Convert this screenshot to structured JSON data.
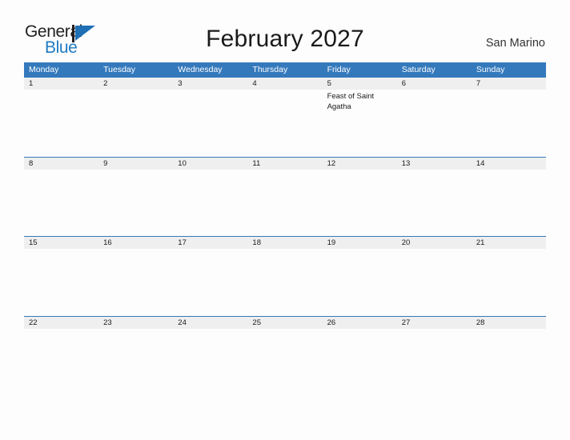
{
  "brand": {
    "name_part1": "General",
    "name_part2": "Blue",
    "mark_icon": "triangle-flag-icon",
    "primary_color": "#1f6fb4",
    "dark_color": "#231f20"
  },
  "header": {
    "title": "February 2027",
    "region": "San Marino"
  },
  "theme": {
    "header_blue": "#3479bc",
    "daynum_band_gray": "#efefef",
    "page_background": "#fdfdfd",
    "text_color": "#1a1a1a"
  },
  "calendar": {
    "month": "February",
    "year": "2027",
    "weekday_headers": [
      "Monday",
      "Tuesday",
      "Wednesday",
      "Thursday",
      "Friday",
      "Saturday",
      "Sunday"
    ],
    "weeks": [
      {
        "days": [
          {
            "number": "1",
            "events": []
          },
          {
            "number": "2",
            "events": []
          },
          {
            "number": "3",
            "events": []
          },
          {
            "number": "4",
            "events": []
          },
          {
            "number": "5",
            "events": [
              "Feast of Saint Agatha"
            ]
          },
          {
            "number": "6",
            "events": []
          },
          {
            "number": "7",
            "events": []
          }
        ]
      },
      {
        "days": [
          {
            "number": "8",
            "events": []
          },
          {
            "number": "9",
            "events": []
          },
          {
            "number": "10",
            "events": []
          },
          {
            "number": "11",
            "events": []
          },
          {
            "number": "12",
            "events": []
          },
          {
            "number": "13",
            "events": []
          },
          {
            "number": "14",
            "events": []
          }
        ]
      },
      {
        "days": [
          {
            "number": "15",
            "events": []
          },
          {
            "number": "16",
            "events": []
          },
          {
            "number": "17",
            "events": []
          },
          {
            "number": "18",
            "events": []
          },
          {
            "number": "19",
            "events": []
          },
          {
            "number": "20",
            "events": []
          },
          {
            "number": "21",
            "events": []
          }
        ]
      },
      {
        "days": [
          {
            "number": "22",
            "events": []
          },
          {
            "number": "23",
            "events": []
          },
          {
            "number": "24",
            "events": []
          },
          {
            "number": "25",
            "events": []
          },
          {
            "number": "26",
            "events": []
          },
          {
            "number": "27",
            "events": []
          },
          {
            "number": "28",
            "events": []
          }
        ]
      }
    ]
  }
}
